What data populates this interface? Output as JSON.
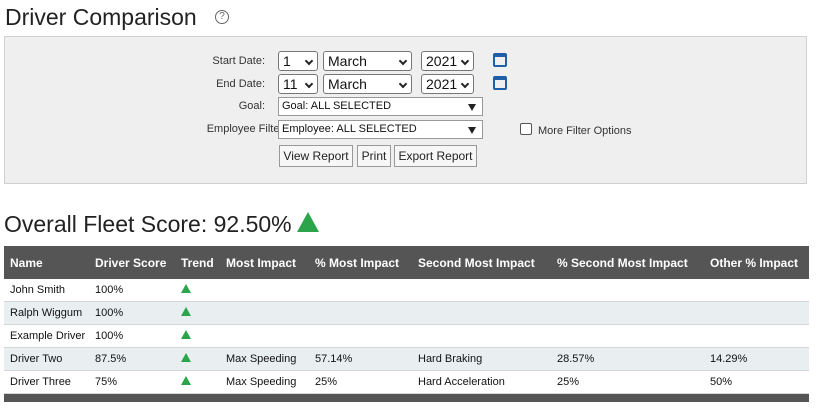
{
  "page": {
    "title": "Driver Comparison",
    "help_icon": "?"
  },
  "filters": {
    "start_date_label": "Start Date:",
    "start_day": "1",
    "start_month": "March",
    "start_year": "2021",
    "end_date_label": "End Date:",
    "end_day": "11",
    "end_month": "March",
    "end_year": "2021",
    "goal_label": "Goal:",
    "goal_value": "Goal: ALL SELECTED",
    "employee_label": "Employee Filter(s):",
    "employee_value": "Employee: ALL SELECTED",
    "more_filter_label": "More Filter Options",
    "calendar_icon": "calendar-icon"
  },
  "actions": {
    "view_report": "View Report",
    "print": "Print",
    "export_report": "Export Report"
  },
  "fleet": {
    "score_text": "Overall Fleet Score: 92.50%",
    "trend": "up",
    "trend_color": "#2ca44c"
  },
  "table": {
    "columns": [
      "Name",
      "Driver Score",
      "Trend",
      "Most Impact",
      "% Most Impact",
      "Second Most Impact",
      "% Second Most Impact",
      "Other % Impact"
    ],
    "rows": [
      [
        "John Smith",
        "100%",
        "up",
        "",
        "",
        "",
        "",
        ""
      ],
      [
        "Ralph Wiggum",
        "100%",
        "up",
        "",
        "",
        "",
        "",
        ""
      ],
      [
        "Example Driver",
        "100%",
        "up",
        "",
        "",
        "",
        "",
        ""
      ],
      [
        "Driver Two",
        "87.5%",
        "up",
        "Max Speeding",
        "57.14%",
        "Hard Braking",
        "28.57%",
        "14.29%"
      ],
      [
        "Driver Three",
        "75%",
        "up",
        "Max Speeding",
        "25%",
        "Hard Acceleration",
        "25%",
        "50%"
      ]
    ]
  },
  "colors": {
    "header_bg": "#555555",
    "alt_row_bg": "#e9eff1",
    "panel_bg": "#efefef",
    "accent_blue": "#1f5fa8"
  }
}
